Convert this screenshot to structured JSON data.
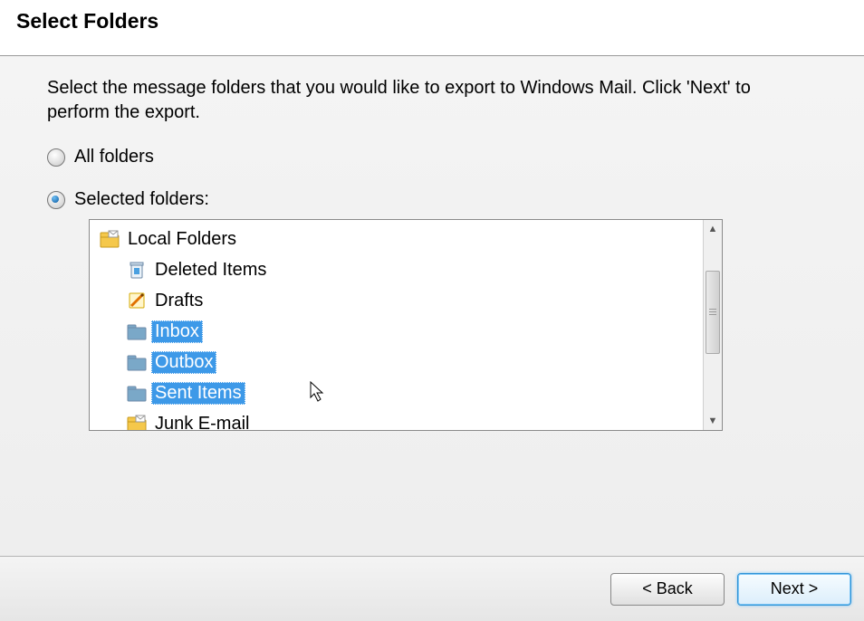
{
  "header": {
    "title": "Select Folders"
  },
  "instructions": "Select the message folders that you would like to export to Windows Mail. Click 'Next' to perform the export.",
  "radios": {
    "all_label": "All folders",
    "selected_label": "Selected folders:",
    "checked": "selected"
  },
  "tree": {
    "root": {
      "label": "Local Folders",
      "icon": "root-folder-icon",
      "children": [
        {
          "label": "Deleted Items",
          "icon": "trash-icon",
          "selected": false
        },
        {
          "label": "Drafts",
          "icon": "drafts-icon",
          "selected": false
        },
        {
          "label": "Inbox",
          "icon": "folder-icon",
          "selected": true
        },
        {
          "label": "Outbox",
          "icon": "folder-icon",
          "selected": true
        },
        {
          "label": "Sent Items",
          "icon": "folder-icon",
          "selected": true
        },
        {
          "label": "Junk E-mail",
          "icon": "junk-icon",
          "selected": false
        }
      ]
    }
  },
  "buttons": {
    "back": "< Back",
    "next": "Next >"
  }
}
